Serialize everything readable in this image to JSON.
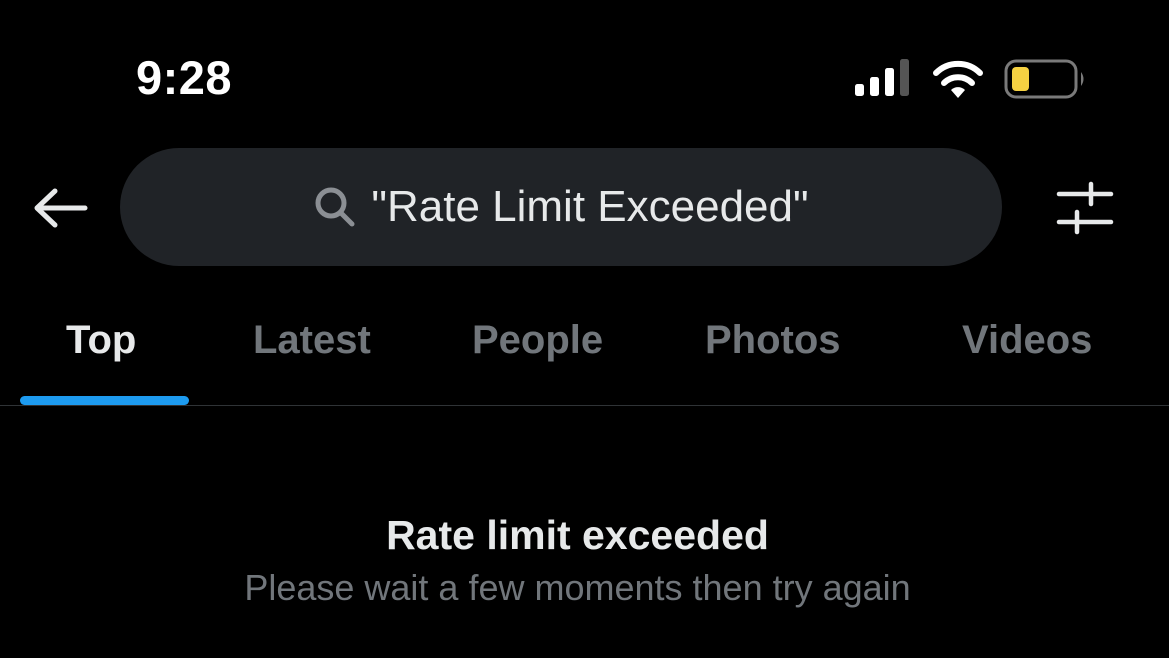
{
  "status_bar": {
    "time": "9:28",
    "signal_icon": "cellular-signal-icon",
    "wifi_icon": "wifi-icon",
    "battery_icon": "battery-low-icon",
    "battery_color": "#f5d142"
  },
  "header": {
    "back_icon": "arrow-left-icon",
    "search": {
      "icon": "search-icon",
      "value": "\"Rate Limit Exceeded\""
    },
    "filter_icon": "sliders-icon"
  },
  "tabs": [
    {
      "label": "Top",
      "active": true
    },
    {
      "label": "Latest",
      "active": false
    },
    {
      "label": "People",
      "active": false
    },
    {
      "label": "Photos",
      "active": false
    },
    {
      "label": "Videos",
      "active": false
    }
  ],
  "colors": {
    "accent": "#1d9bf0",
    "background": "#000000",
    "search_bg": "#202327",
    "muted_text": "#71767b",
    "primary_text": "#e7e9ea"
  },
  "message": {
    "title": "Rate limit exceeded",
    "subtitle": "Please wait a few moments then try again"
  }
}
